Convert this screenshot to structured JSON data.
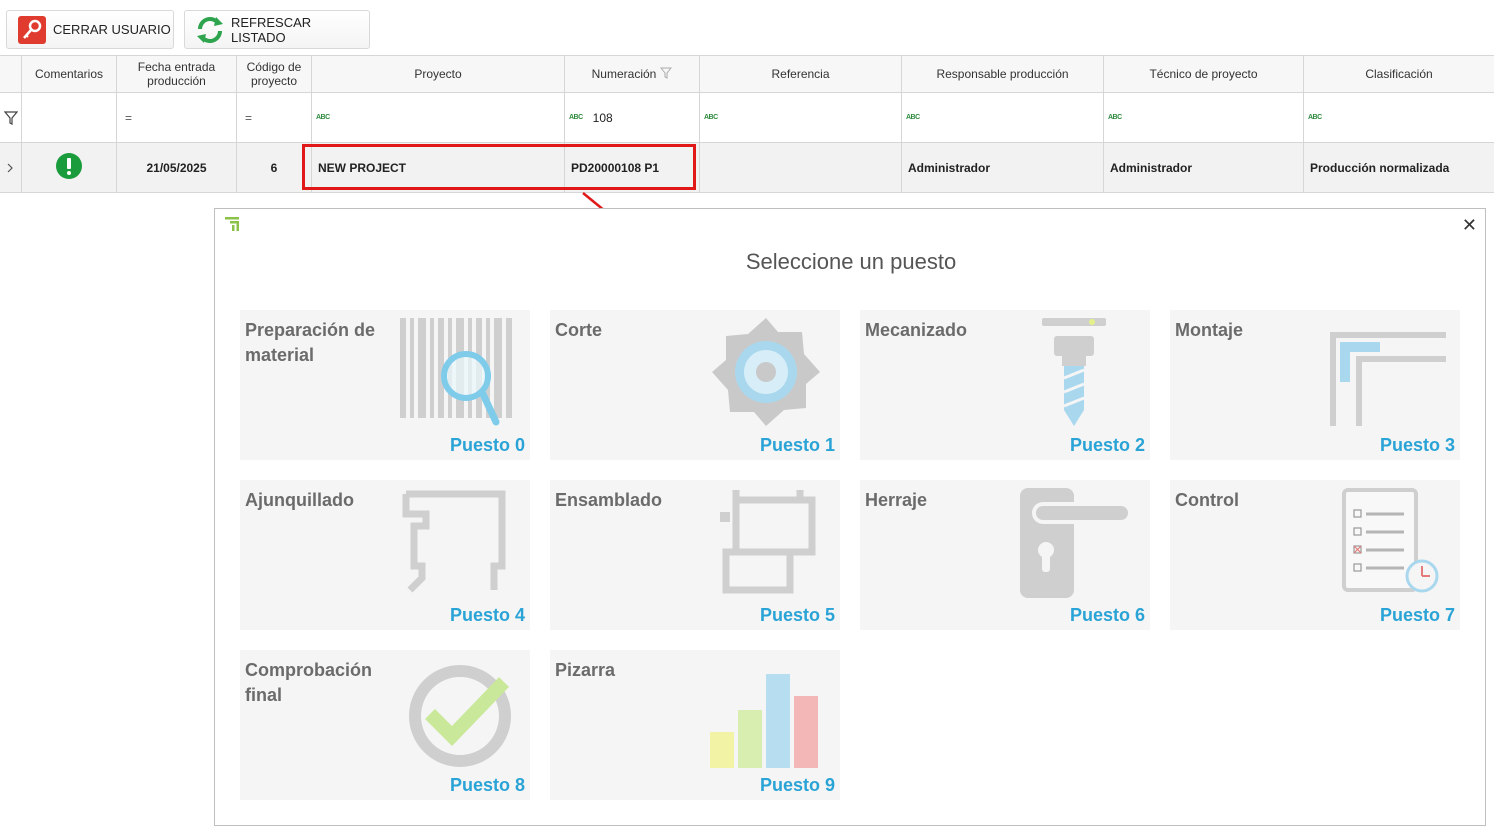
{
  "toolbar": {
    "close_user_label": "CERRAR USUARIO",
    "refresh_label": "REFRESCAR LISTADO"
  },
  "grid": {
    "headers": {
      "comentarios": "Comentarios",
      "fecha_1": "Fecha entrada",
      "fecha_2": "producción",
      "codigo_1": "Código de",
      "codigo_2": "proyecto",
      "proyecto": "Proyecto",
      "numeracion": "Numeración",
      "referencia": "Referencia",
      "responsable": "Responsable producción",
      "tecnico": "Técnico de proyecto",
      "clasificacion": "Clasificación"
    },
    "filter": {
      "numeracion_value": "108",
      "abc_glyph": "ABC",
      "eq_glyph": "="
    },
    "row": {
      "fecha": "21/05/2025",
      "codigo": "6",
      "proyecto": "NEW PROJECT",
      "numeracion": "PD20000108 P1",
      "referencia": "",
      "responsable": "Administrador",
      "tecnico": "Administrador",
      "clasificacion": "Producción normalizada"
    }
  },
  "dialog": {
    "title": "Seleccione un puesto",
    "tiles": [
      {
        "name": "Preparación de material",
        "num": "Puesto 0",
        "icon": "barcode-search-icon"
      },
      {
        "name": "Corte",
        "num": "Puesto 1",
        "icon": "saw-blade-icon"
      },
      {
        "name": "Mecanizado",
        "num": "Puesto 2",
        "icon": "drill-bit-icon"
      },
      {
        "name": "Montaje",
        "num": "Puesto 3",
        "icon": "frame-corner-icon"
      },
      {
        "name": "Ajunquillado",
        "num": "Puesto 4",
        "icon": "profile-icon"
      },
      {
        "name": "Ensamblado",
        "num": "Puesto 5",
        "icon": "assembly-icon"
      },
      {
        "name": "Herraje",
        "num": "Puesto 6",
        "icon": "door-handle-icon"
      },
      {
        "name": "Control",
        "num": "Puesto 7",
        "icon": "checklist-icon"
      },
      {
        "name": "Comprobación final",
        "num": "Puesto 8",
        "icon": "check-circle-icon"
      },
      {
        "name": "Pizarra",
        "num": "Puesto 9",
        "icon": "bar-chart-icon"
      }
    ]
  },
  "colors": {
    "accent": "#2aa3d6",
    "highlight": "#e01818",
    "status_ok": "#1a9c3c"
  }
}
